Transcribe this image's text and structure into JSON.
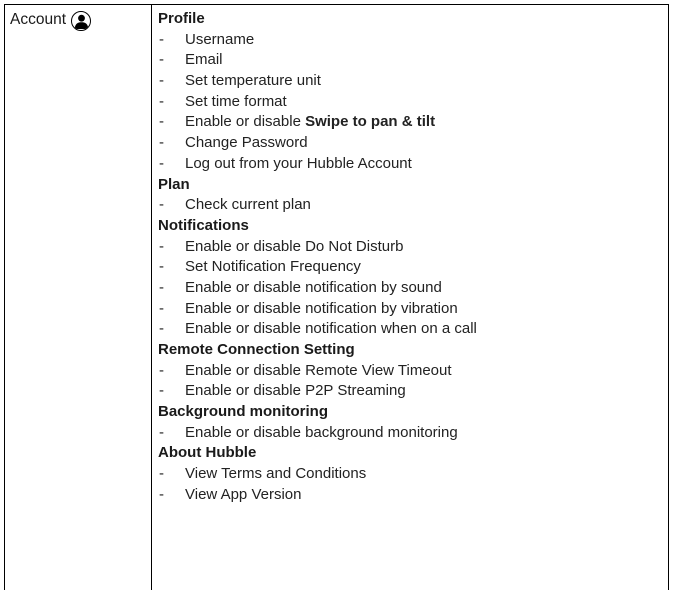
{
  "account_label": "Account",
  "sections": [
    {
      "title": "Profile",
      "items": [
        {
          "text": "Username"
        },
        {
          "text": "Email"
        },
        {
          "text": "Set temperature unit"
        },
        {
          "text": "Set time format"
        },
        {
          "text": "Enable or disable ",
          "bold": "Swipe to pan & tilt"
        },
        {
          "text": "Change Password"
        },
        {
          "text": "Log out from your Hubble Account"
        }
      ]
    },
    {
      "title": "Plan",
      "items": [
        {
          "text": "Check current plan"
        }
      ]
    },
    {
      "title": "Notifications",
      "items": [
        {
          "text": "Enable or disable Do Not Disturb"
        },
        {
          "text": "Set Notification Frequency"
        },
        {
          "text": "Enable or disable notification by sound"
        },
        {
          "text": "Enable or disable notification by vibration"
        },
        {
          "text": "Enable or disable notification when on a call"
        }
      ]
    },
    {
      "title": "Remote Connection Setting",
      "items": [
        {
          "text": "Enable or disable Remote View Timeout"
        },
        {
          "text": "Enable or disable P2P Streaming"
        }
      ]
    },
    {
      "title": "Background monitoring",
      "items": [
        {
          "text": "Enable or disable background monitoring"
        }
      ]
    },
    {
      "title": "About Hubble",
      "items": [
        {
          "text": "View Terms and Conditions"
        },
        {
          "text": "View App Version"
        }
      ]
    }
  ],
  "bullet": "-"
}
